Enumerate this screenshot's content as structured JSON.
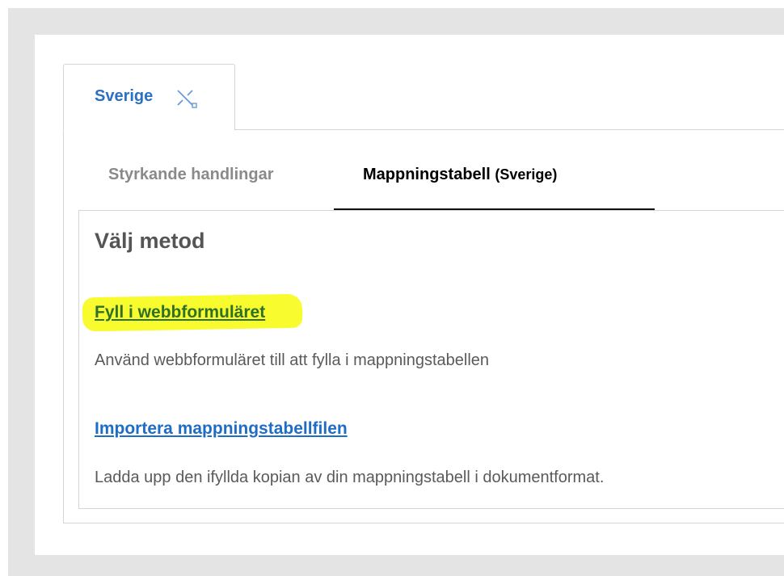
{
  "country_tab": {
    "label": "Sverige",
    "icon": "unlink-icon"
  },
  "subtabs": [
    {
      "label": "Styrkande handlingar",
      "suffix": "",
      "active": false
    },
    {
      "label": "Mappningstabell",
      "suffix": "(Sverige)",
      "active": true
    }
  ],
  "panel": {
    "title": "Välj metod",
    "methods": [
      {
        "link": "Fyll i webbformuläret",
        "description": "Använd webbformuläret till att fylla i mappningstabellen",
        "highlighted": true
      },
      {
        "link": "Importera mappningstabellfilen",
        "description": "Ladda upp den ifyllda kopian av din mappningstabell i dokumentformat.",
        "highlighted": false
      }
    ]
  },
  "colors": {
    "link_blue": "#1f6cc4",
    "link_green": "#2e6f2a",
    "highlight_yellow": "#f8fb2d",
    "tab_blue": "#2d6fc2"
  }
}
